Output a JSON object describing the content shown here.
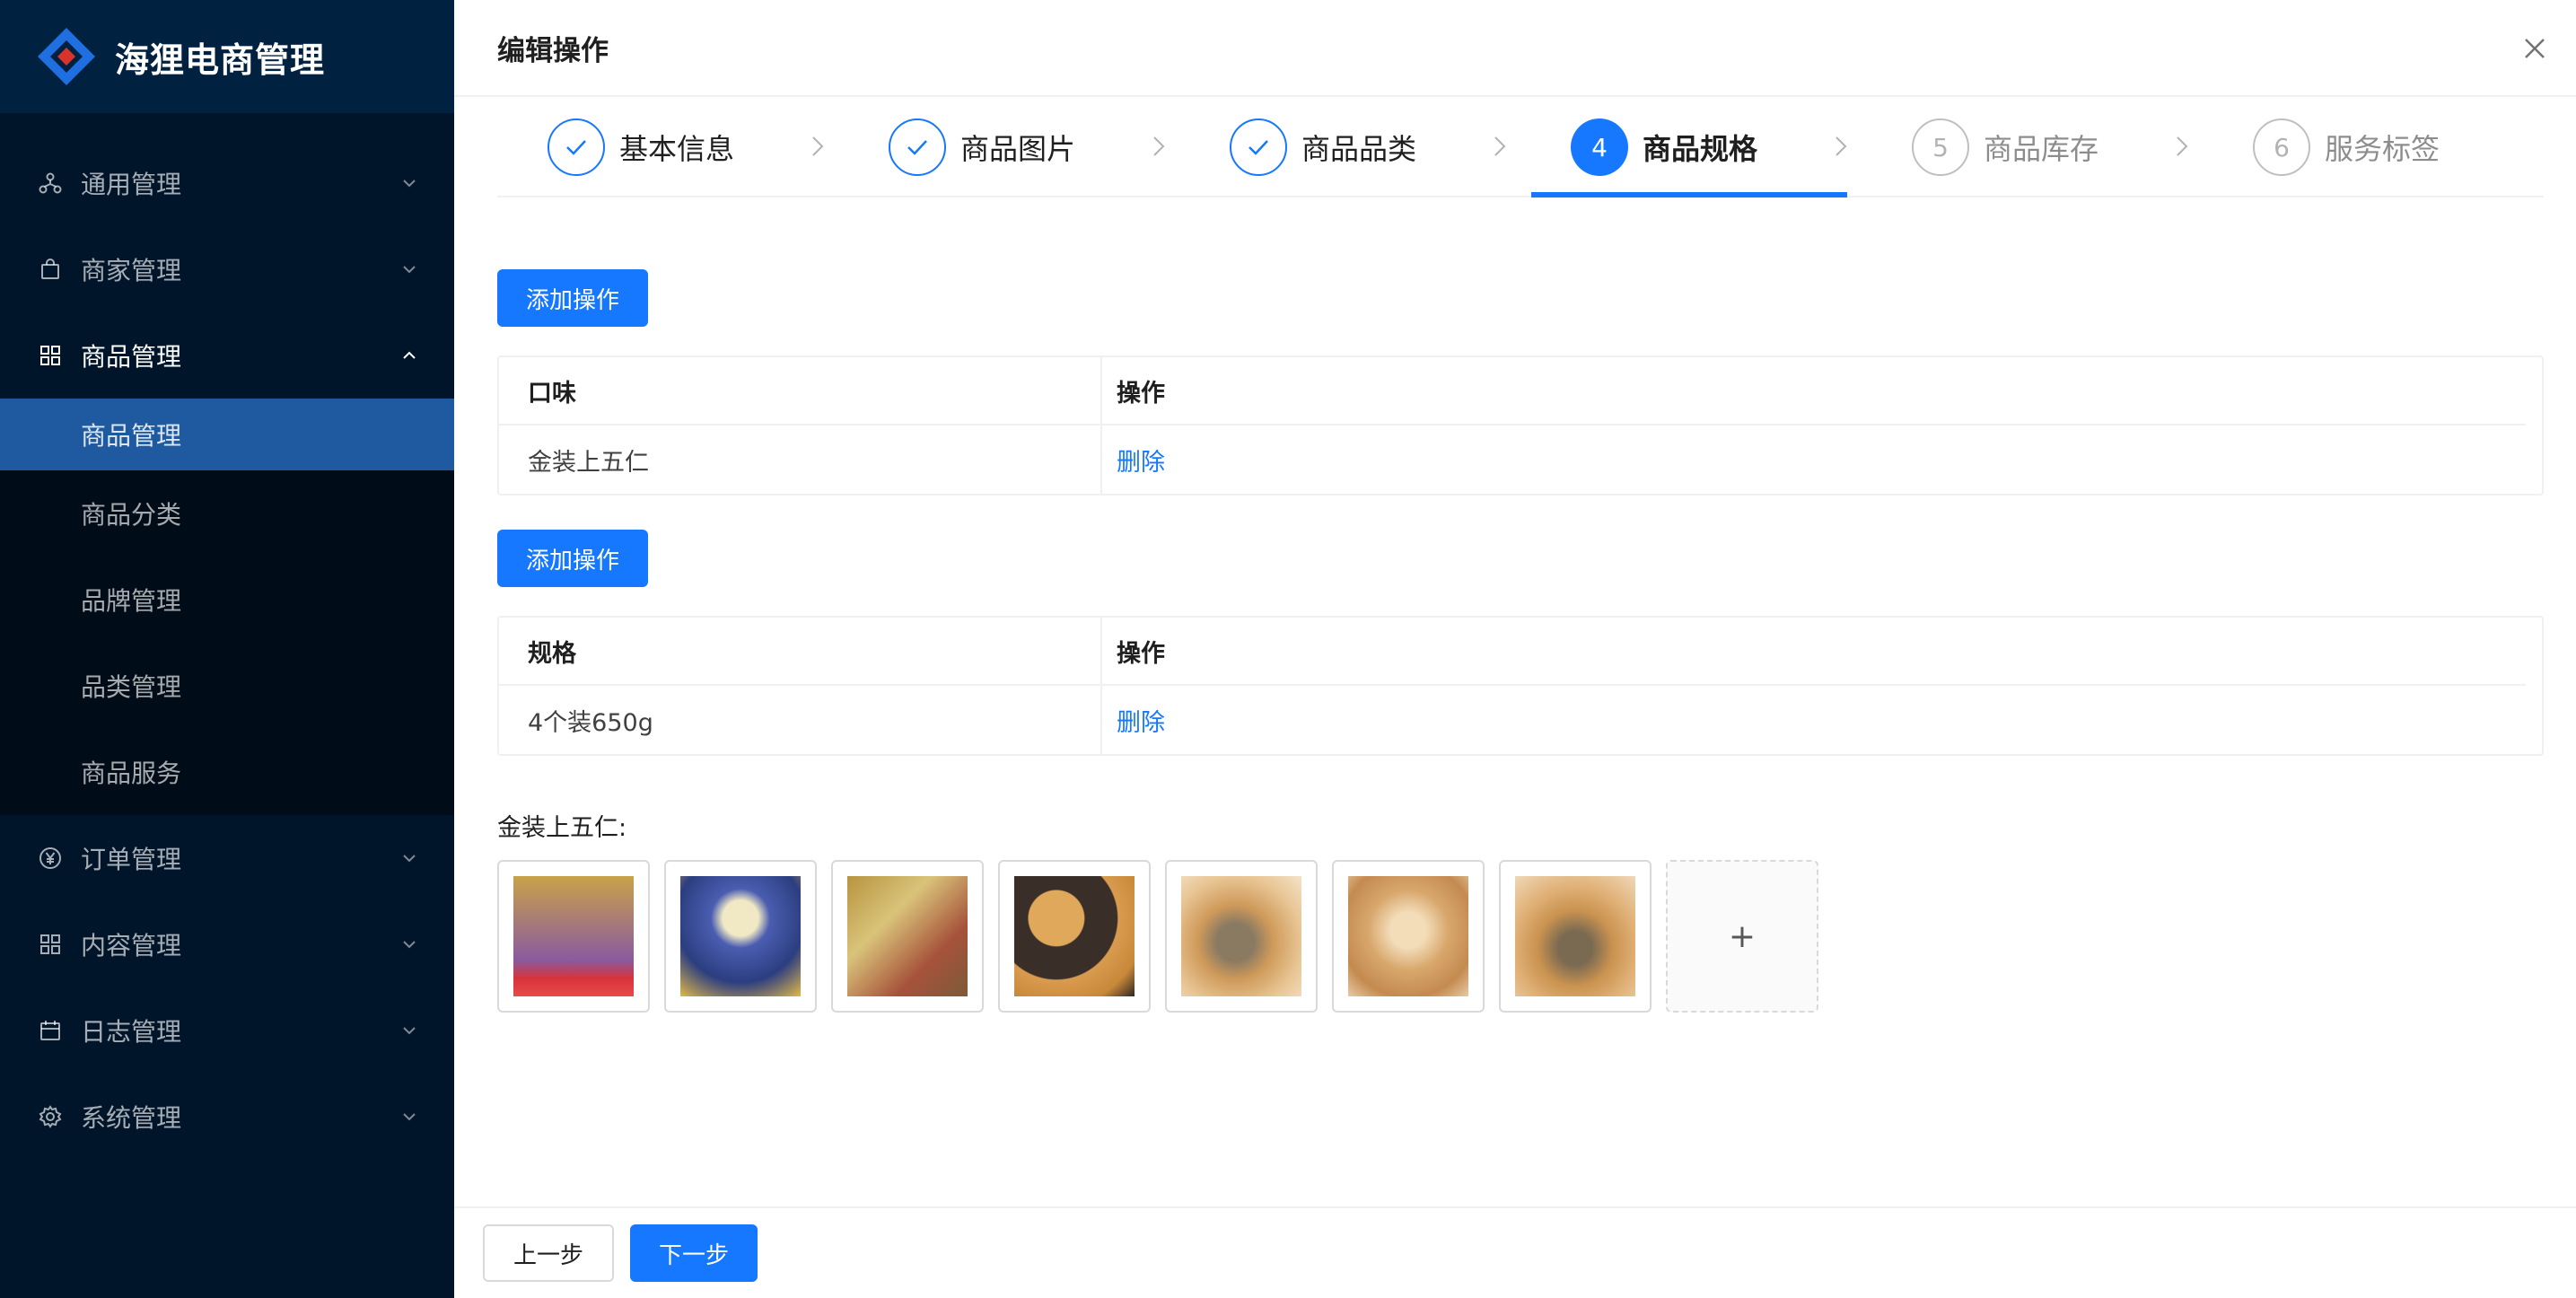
{
  "app": {
    "title": "海狸电商管理"
  },
  "sidebar": {
    "menus": [
      {
        "label": "通用管理",
        "icon": "cluster-icon",
        "state": "collapsed"
      },
      {
        "label": "商家管理",
        "icon": "shop-bag-icon",
        "state": "collapsed"
      },
      {
        "label": "商品管理",
        "icon": "grid-icon",
        "state": "expanded",
        "children": [
          "商品管理",
          "商品分类",
          "品牌管理",
          "品类管理",
          "商品服务"
        ],
        "active_child": "商品管理"
      },
      {
        "label": "订单管理",
        "icon": "yen-circle-icon",
        "state": "collapsed"
      },
      {
        "label": "内容管理",
        "icon": "grid-icon",
        "state": "collapsed"
      },
      {
        "label": "日志管理",
        "icon": "calendar-icon",
        "state": "collapsed"
      },
      {
        "label": "系统管理",
        "icon": "gear-icon",
        "state": "collapsed"
      }
    ]
  },
  "drawer": {
    "title": "编辑操作",
    "steps": [
      {
        "number": "1",
        "label": "基本信息",
        "status": "finish"
      },
      {
        "number": "2",
        "label": "商品图片",
        "status": "finish"
      },
      {
        "number": "3",
        "label": "商品品类",
        "status": "finish"
      },
      {
        "number": "4",
        "label": "商品规格",
        "status": "process"
      },
      {
        "number": "5",
        "label": "商品库存",
        "status": "wait"
      },
      {
        "number": "6",
        "label": "服务标签",
        "status": "wait"
      }
    ],
    "add_button_label": "添加操作",
    "table1": {
      "headers": [
        "口味",
        "操作"
      ],
      "rows": [
        {
          "value": "金装上五仁",
          "action": "删除"
        }
      ]
    },
    "table2": {
      "headers": [
        "规格",
        "操作"
      ],
      "rows": [
        {
          "value": "4个装650g",
          "action": "删除"
        }
      ]
    },
    "images": {
      "label": "金装上五仁:",
      "count": 7,
      "upload_icon": "+"
    },
    "footer": {
      "prev_label": "上一步",
      "next_label": "下一步"
    }
  },
  "colors": {
    "primary": "#1677ff",
    "sidebar_bg": "#001529",
    "sidebar_active": "#1f5aa0"
  }
}
